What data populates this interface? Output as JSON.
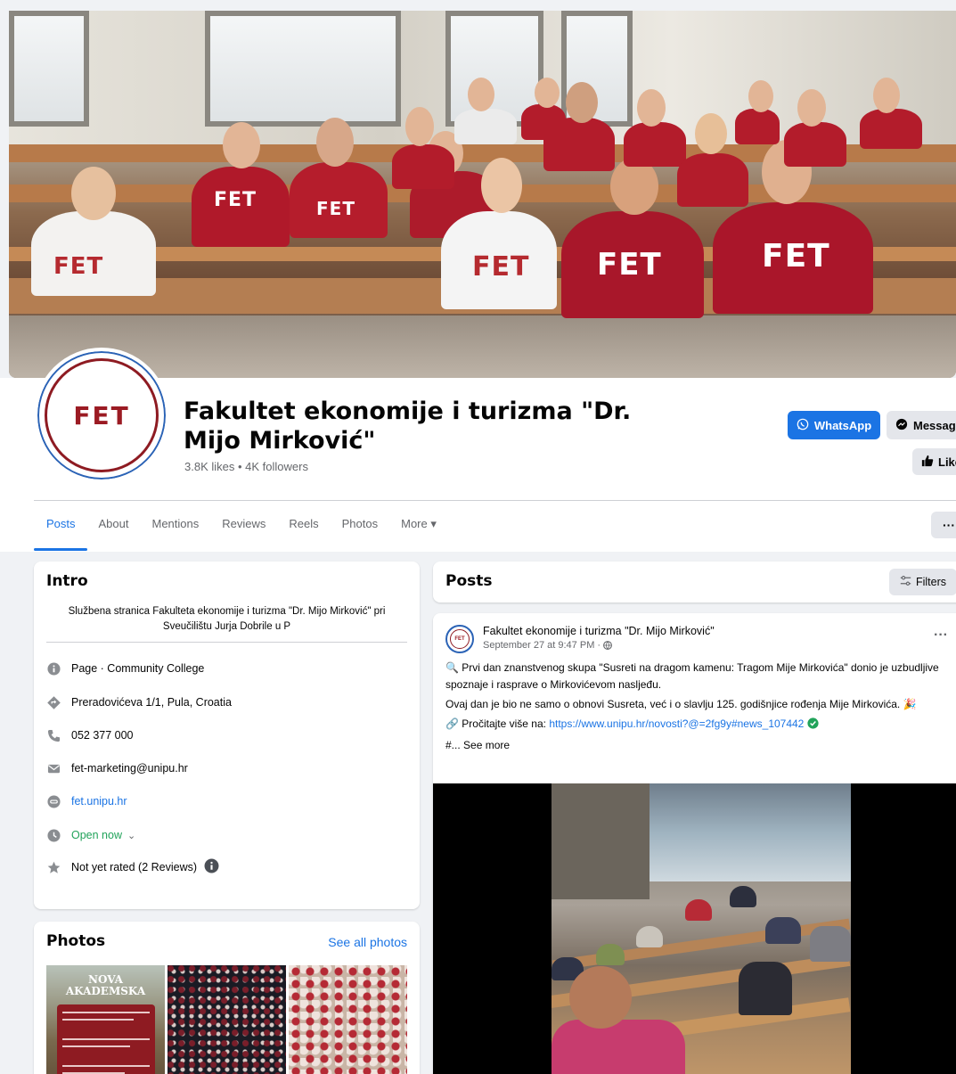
{
  "page": {
    "name": "Fakultet ekonomije i turizma \"Dr. Mijo Mirković\"",
    "stats": "3.8K likes • 4K followers",
    "avatar_text": "FET"
  },
  "actions": {
    "whatsapp_label": "WhatsApp",
    "message_label": "Message",
    "like_label": "Like",
    "more_label": "···"
  },
  "tabs": [
    "Posts",
    "About",
    "Mentions",
    "Reviews",
    "Reels",
    "Photos",
    "More ▾"
  ],
  "intro": {
    "title": "Intro",
    "bio": "Službena stranica Fakulteta ekonomije i turizma \"Dr. Mijo Mirković\" pri Sveučilištu Jurja Dobrile u P",
    "category": "Page · Community College",
    "address": "Preradovićeva 1/1, Pula, Croatia",
    "phone": "052 377 000",
    "email": "fet-marketing@unipu.hr",
    "website": "fet.unipu.hr",
    "hours": "Open now",
    "rating": "Not yet rated (2 Reviews)"
  },
  "photos": {
    "title": "Photos",
    "see_all": "See all photos",
    "thumb1_title": "NOVA\nAKADEMSKA"
  },
  "posts_header": {
    "title": "Posts",
    "filters_label": "Filters"
  },
  "post": {
    "author": "Fakultet ekonomije i turizma \"Dr. Mijo Mirković\"",
    "time": "September 27 at 9:47 PM · ",
    "line1": "🔍 Prvi dan znanstvenog skupa \"Susreti na dragom kamenu: Tragom Mije Mirkovića\" donio je uzbudljive spoznaje i rasprave o Mirkovićevom nasljeđu.",
    "line2": "Ovaj dan je bio ne samo o obnovi Susreta, već i o slavlju 125. godišnjice rođenja Mije Mirkovića. 🎉",
    "line3_prefix": "🔗 Pročitajte više na: ",
    "line3_link": "https://www.unipu.hr/novosti?@=2fg9y#news_107442",
    "see_more": "#... See more"
  },
  "colors": {
    "facebook_blue": "#1b74e4",
    "fet_red": "#9b1b23",
    "open_green": "#21a35a"
  }
}
